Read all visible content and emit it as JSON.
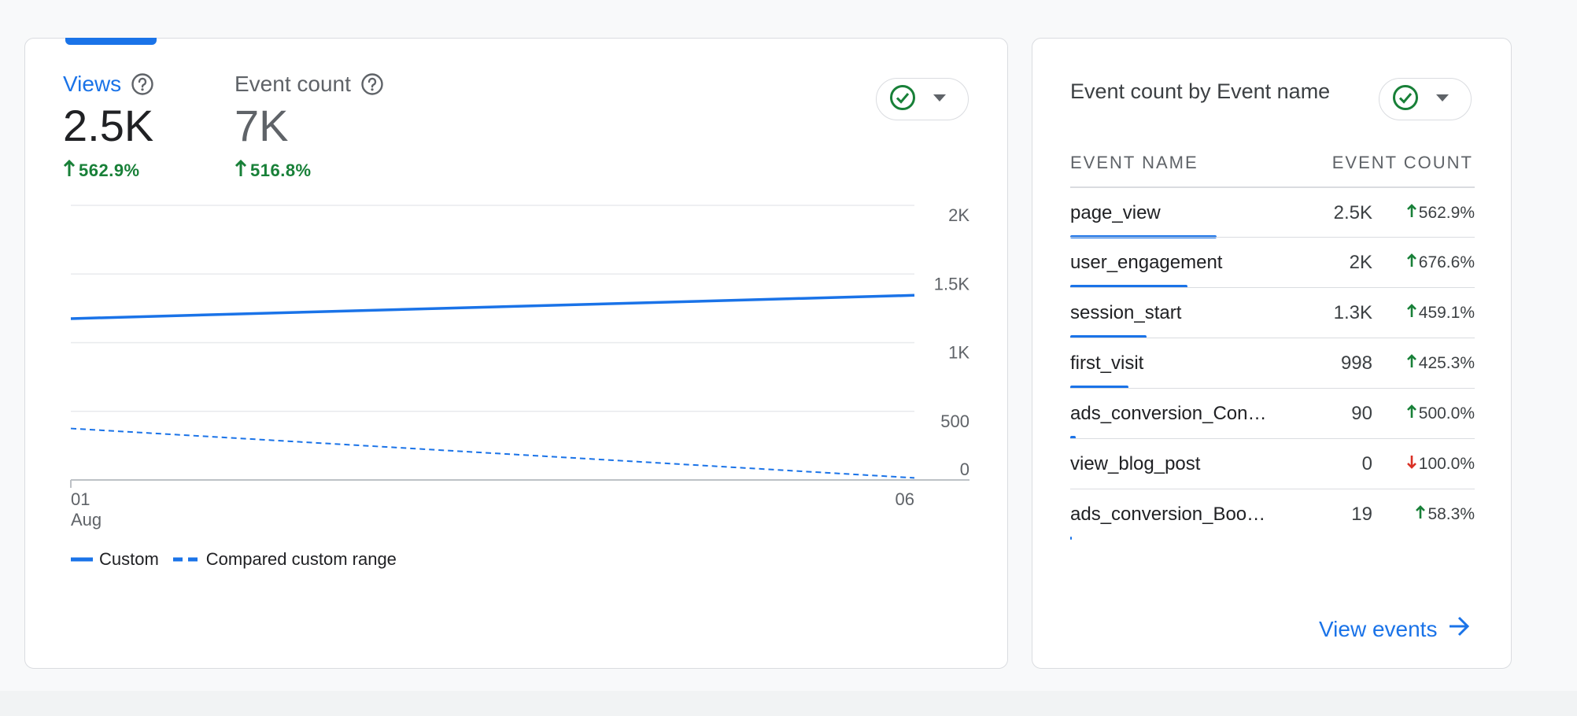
{
  "left_card": {
    "metrics": [
      {
        "label": "Views",
        "value": "2.5K",
        "change": "562.9%"
      },
      {
        "label": "Event count",
        "value": "7K",
        "change": "516.8%"
      }
    ],
    "chart_data": {
      "type": "line",
      "x": [
        "01 Aug",
        "06"
      ],
      "x_tick_labels": [
        "01",
        "Aug",
        "06"
      ],
      "y_ticks": [
        "2K",
        "1.5K",
        "1K",
        "500",
        "0"
      ],
      "ylim": [
        0,
        2000
      ],
      "grid": true,
      "series": [
        {
          "name": "Custom",
          "style": "solid",
          "color": "#1a73e8",
          "values": [
            1175,
            1345
          ]
        },
        {
          "name": "Compared custom range",
          "style": "dashed",
          "color": "#1a73e8",
          "values": [
            375,
            15
          ]
        }
      ],
      "legend_placement": "bottom-left"
    }
  },
  "right_card": {
    "title": "Event count by Event name",
    "columns": [
      "EVENT NAME",
      "EVENT COUNT"
    ],
    "rows": [
      {
        "name": "page_view",
        "count": "2.5K",
        "change": "562.9%",
        "direction": "up",
        "share": 0.294
      },
      {
        "name": "user_engagement",
        "count": "2K",
        "change": "676.6%",
        "direction": "up",
        "share": 0.235
      },
      {
        "name": "session_start",
        "count": "1.3K",
        "change": "459.1%",
        "direction": "up",
        "share": 0.153
      },
      {
        "name": "first_visit",
        "count": "998",
        "change": "425.3%",
        "direction": "up",
        "share": 0.117
      },
      {
        "name": "ads_conversion_Con…",
        "count": "90",
        "change": "500.0%",
        "direction": "up",
        "share": 0.011
      },
      {
        "name": "view_blog_post",
        "count": "0",
        "change": "100.0%",
        "direction": "down",
        "share": 0
      },
      {
        "name": "ads_conversion_Boo…",
        "count": "19",
        "change": "58.3%",
        "direction": "up",
        "share": 0.002
      }
    ],
    "link": "View events"
  },
  "colors": {
    "accent": "#1a73e8",
    "positive": "#188038",
    "negative": "#d93025",
    "check": "#188038"
  }
}
